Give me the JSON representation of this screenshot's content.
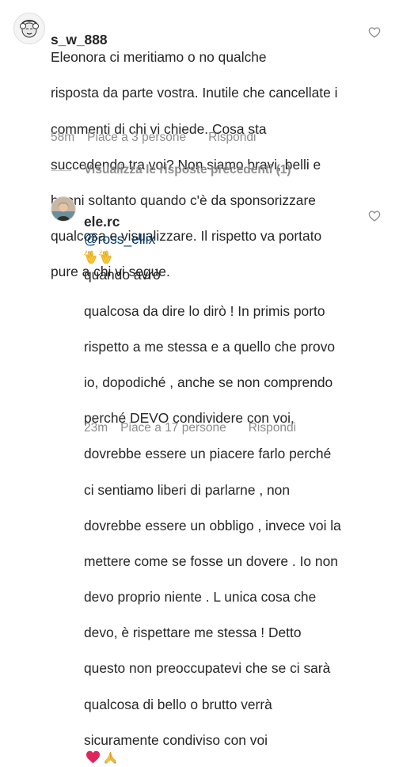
{
  "comments": [
    {
      "username": "s_w_888",
      "text": "Eleonora ci meritiamo o no qualche risposta da parte vostra. Inutile che cancellate i commenti di chi vi chiede. Cosa sta succedendo tra voi? Non siamo bravi, belli e buoni soltanto quando c'è da sponsorizzare qualcosa  e visualizzare. Il rispetto va portato pure a chi vi segue.",
      "lines": [
        "Eleonora ci meritiamo o no qualche",
        "risposta da parte vostra. Inutile che cancellate i",
        "commenti di chi vi chiede. Cosa sta",
        "succedendo tra voi? Non siamo bravi, belli e",
        "buoni soltanto quando c'è da sponsorizzare",
        "qualcosa  e visualizzare. Il rispetto va portato",
        "pure a chi vi segue."
      ],
      "time": "58m",
      "likes": "Piace a 3 persone",
      "reply": "Rispondi",
      "avatar_icon": "marilyn-portrait-icon",
      "like_icon": "heart-outline-icon"
    },
    {
      "username": "ele.rc",
      "mention": "@ross_ellix",
      "mention_emoji": "clapping-hands-emoji",
      "lines": [
        "quando avrò",
        "qualcosa da dire lo dirò ! In primis porto",
        "rispetto a me stessa e a quello che provo",
        "io, dopodiché , anche se non comprendo",
        "perché DEVO condividere con voi,",
        "dovrebbe essere un piacere farlo perché",
        "ci sentiamo liberi di parlarne , non",
        "dovrebbe essere un obbligo , invece voi la",
        "mettere come se fosse un dovere . Io non",
        "devo proprio niente . L unica cosa che",
        "devo, è rispettare me stessa ! Detto",
        "questo non preoccupatevi che se ci sarà",
        "qualcosa di bello o brutto verrà",
        "sicuramente condiviso con voi"
      ],
      "end_emojis": [
        "red-heart-emoji",
        "folded-hands-emoji"
      ],
      "time": "23m",
      "likes": "Piace a 17 persone",
      "reply": "Rispondi",
      "avatar_icon": "profile-photo-icon",
      "like_icon": "heart-outline-icon"
    }
  ],
  "view_previous_replies": "Visualizza le risposte precedenti (1)",
  "colors": {
    "text": "#262626",
    "secondary": "#8e8e8e",
    "mention": "#00376b",
    "emoji_heart": "#e0245e",
    "emoji_yellow": "#f7c331"
  }
}
